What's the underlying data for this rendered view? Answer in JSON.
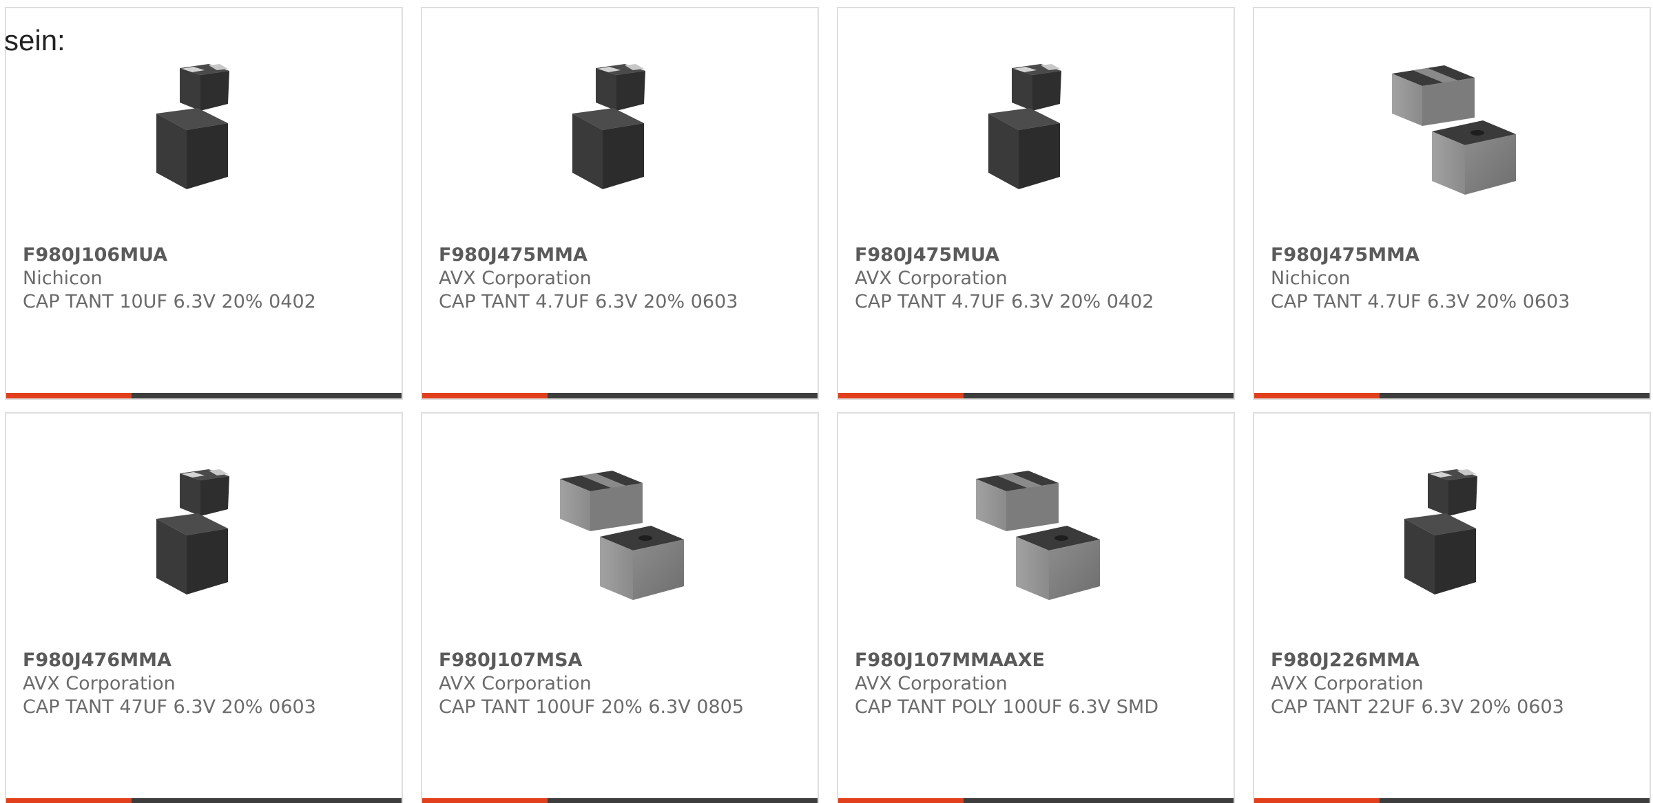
{
  "intro_text": "sein:",
  "colors": {
    "accent": "#e2401c",
    "bar": "#3d3d3d",
    "border": "#dedede",
    "text": "#6b6b6b"
  },
  "products": [
    {
      "part_number": "F980J106MUA",
      "manufacturer": "Nichicon",
      "description": "CAP TANT 10UF 6.3V 20% 0402",
      "image": "black-chip-capacitor-icon"
    },
    {
      "part_number": "F980J475MMA",
      "manufacturer": "AVX Corporation",
      "description": "CAP TANT 4.7UF 6.3V 20% 0603",
      "image": "black-chip-capacitor-icon"
    },
    {
      "part_number": "F980J475MUA",
      "manufacturer": "AVX Corporation",
      "description": "CAP TANT 4.7UF 6.3V 20% 0402",
      "image": "black-chip-capacitor-icon"
    },
    {
      "part_number": "F980J475MMA",
      "manufacturer": "Nichicon",
      "description": "CAP TANT 4.7UF 6.3V 20% 0603",
      "image": "gray-chip-capacitor-icon"
    },
    {
      "part_number": "F980J476MMA",
      "manufacturer": "AVX Corporation",
      "description": "CAP TANT 47UF 6.3V 20% 0603",
      "image": "black-chip-capacitor-icon"
    },
    {
      "part_number": "F980J107MSA",
      "manufacturer": "AVX Corporation",
      "description": "CAP TANT 100UF 20% 6.3V 0805",
      "image": "gray-chip-capacitor-icon"
    },
    {
      "part_number": "F980J107MMAAXE",
      "manufacturer": "AVX Corporation",
      "description": "CAP TANT POLY 100UF 6.3V SMD",
      "image": "gray-chip-capacitor-icon"
    },
    {
      "part_number": "F980J226MMA",
      "manufacturer": "AVX Corporation",
      "description": "CAP TANT 22UF 6.3V 20% 0603",
      "image": "black-chip-capacitor-icon"
    }
  ]
}
